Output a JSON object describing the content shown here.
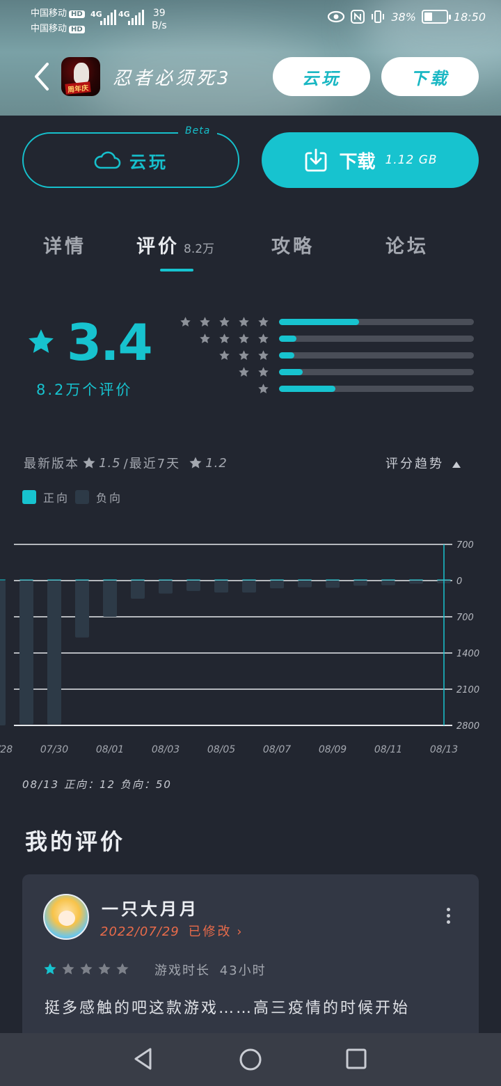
{
  "status_bar": {
    "carrier1": "中国移动",
    "carrier2": "中国移动",
    "hd": "HD",
    "net1": "4G",
    "net2": "4G",
    "speed_value": "39",
    "speed_unit": "B/s",
    "battery": "38%",
    "battery_level": 0.38,
    "time": "18:50"
  },
  "header": {
    "icon_badge": "周年庆",
    "title": "忍者必须死3",
    "cloud_label": "云玩",
    "download_label": "下载"
  },
  "actions": {
    "cloud_label": "云玩",
    "beta": "Beta",
    "download_label": "下载",
    "download_size": "1.12 GB"
  },
  "tabs": [
    {
      "label": "详情",
      "count": ""
    },
    {
      "label": "评价",
      "count": "8.2万"
    },
    {
      "label": "攻略",
      "count": ""
    },
    {
      "label": "论坛",
      "count": ""
    }
  ],
  "rating": {
    "score": "3.4",
    "reviews": "8.2万个评价",
    "distribution": [
      {
        "stars": 5,
        "fraction": 0.41
      },
      {
        "stars": 4,
        "fraction": 0.09
      },
      {
        "stars": 3,
        "fraction": 0.08
      },
      {
        "stars": 2,
        "fraction": 0.12
      },
      {
        "stars": 1,
        "fraction": 0.29
      }
    ]
  },
  "version": {
    "latest_label": "最新版本",
    "latest_score": "1.5",
    "recent_label": "/最近7天",
    "recent_score": "1.2",
    "trend_label": "评分趋势"
  },
  "legend": {
    "positive": "正向",
    "negative": "负向",
    "positive_color": "#17c3cf",
    "negative_color": "#2d3a47"
  },
  "chart_data": {
    "type": "bar",
    "x": [
      "07/28",
      "07/29",
      "07/30",
      "07/31",
      "08/01",
      "08/02",
      "08/03",
      "08/04",
      "08/05",
      "08/06",
      "08/07",
      "08/08",
      "08/09",
      "08/10",
      "08/11",
      "08/12",
      "08/13"
    ],
    "x_tick_labels": [
      "07/28",
      "07/30",
      "08/01",
      "08/03",
      "08/05",
      "08/07",
      "08/09",
      "08/11",
      "08/13"
    ],
    "y_tick_labels": [
      "700",
      "0",
      "700",
      "1400",
      "2100",
      "2800"
    ],
    "series": [
      {
        "name": "正向",
        "values": [
          60,
          40,
          30,
          20,
          15,
          12,
          10,
          8,
          7,
          6,
          5,
          5,
          4,
          4,
          3,
          3,
          12
        ]
      },
      {
        "name": "负向",
        "values": [
          2800,
          2780,
          2780,
          1100,
          700,
          350,
          250,
          200,
          230,
          230,
          150,
          130,
          140,
          100,
          90,
          60,
          50
        ]
      }
    ],
    "ylim": [
      -700,
      2800
    ]
  },
  "summary": "08/13 正向：12  负向：50",
  "my_review": {
    "heading": "我的评价",
    "username": "一只大月月",
    "date": "2022/07/29",
    "edited": "已修改",
    "stars": 1,
    "playtime_label": "游戏时长",
    "playtime_value": "43小时",
    "text": "挺多感触的吧这款游戏……高三疫情的时候开始"
  }
}
